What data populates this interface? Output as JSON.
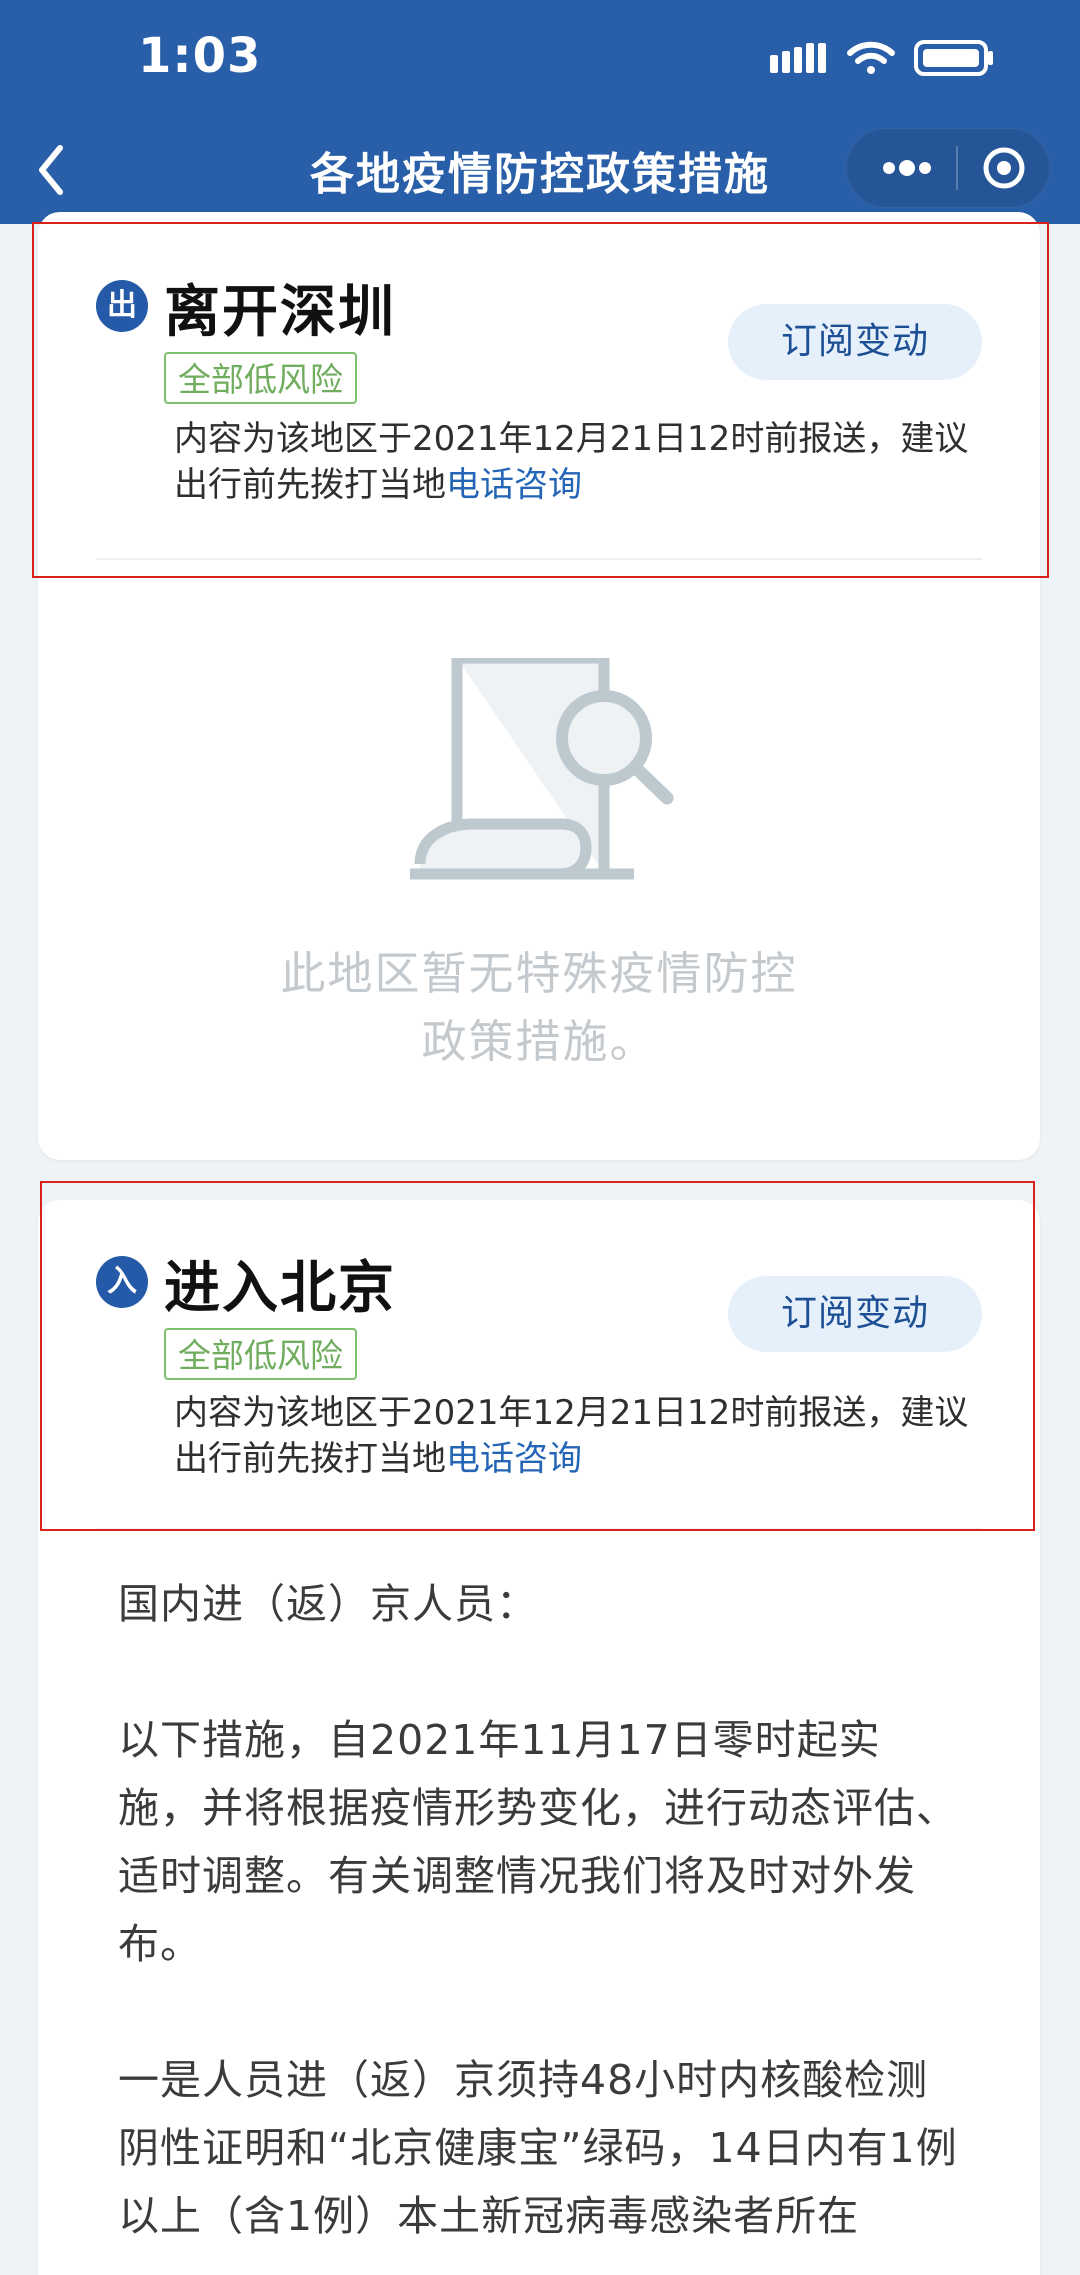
{
  "status_bar": {
    "time": "1:03"
  },
  "navigation": {
    "title": "各地疫情防控政策措施"
  },
  "departure": {
    "badge": "出",
    "place": "离开深圳",
    "risk_tag": "全部低风险",
    "subscribe_label": "订阅变动",
    "notice": "内容为该地区于2021年12月21日12时前报送，建议出行前先拨打当地",
    "phone_link": "电话咨询",
    "empty_line_1": "此地区暂无特殊疫情防控",
    "empty_line_2": "政策措施。"
  },
  "arrival": {
    "badge": "入",
    "place": "进入北京",
    "risk_tag": "全部低风险",
    "subscribe_label": "订阅变动",
    "notice": "内容为该地区于2021年12月21日12时前报送，建议出行前先拨打当地",
    "phone_link": "电话咨询",
    "policy": [
      "国内进（返）京人员：",
      "以下措施，自2021年11月17日零时起实施，并将根据疫情形势变化，进行动态评估、适时调整。有关调整情况我们将及时对外发布。",
      "一是人员进（返）京须持48小时内核酸检测阴性证明和“北京健康宝”绿码，14日内有1例以上（含1例）本土新冠病毒感染者所在"
    ]
  },
  "colors": {
    "primary": "#295ea8",
    "badge": "#245aa7",
    "risk_green": "#70ad5d",
    "link_blue": "#2465b5",
    "highlight_red": "#d9201b",
    "page_bg": "#edf3f7"
  }
}
